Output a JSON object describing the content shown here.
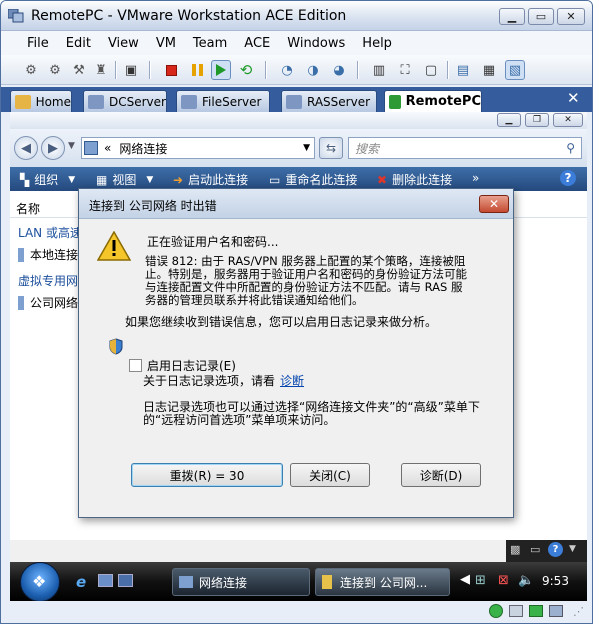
{
  "window": {
    "title": "RemotePC - VMware Workstation ACE Edition"
  },
  "menu": [
    "File",
    "Edit",
    "View",
    "VM",
    "Team",
    "ACE",
    "Windows",
    "Help"
  ],
  "tabs": [
    {
      "label": "Home"
    },
    {
      "label": "DCServer"
    },
    {
      "label": "FileServer"
    },
    {
      "label": "RASServer"
    },
    {
      "label": "RemotePC",
      "active": true
    }
  ],
  "guest": {
    "address_prefix": "«",
    "address": "网络连接",
    "search_placeholder": "搜索",
    "commands": [
      "组织",
      "视图",
      "启动此连接",
      "重命名此连接",
      "删除此连接"
    ],
    "more": "»",
    "column_name": "名称",
    "list": [
      "LAN 或高速",
      "本地连接",
      "虚拟专用网",
      "公司网络"
    ],
    "taskbar": {
      "btn1": "网络连接",
      "btn2": "连接到 公司网...",
      "clock": "9:53"
    }
  },
  "dialog": {
    "title": "连接到 公司网络 时出错",
    "status": "正在验证用户名和密码...",
    "error": "错误 812: 由于 RAS/VPN 服务器上配置的某个策略，连接被阻止。特别是，服务器用于验证用户名和密码的身份验证方法可能与连接配置文件中所配置的身份验证方法不匹配。请与 RAS 服务器的管理员联系并将此错误通知给他们。",
    "log_hint": "如果您继续收到错误信息，您可以启用日志记录来做分析。",
    "checkbox_label": "启用日志记录(E)",
    "about_log": "关于日志记录选项，请看",
    "diag_link": "诊断",
    "advanced_note": "日志记录选项也可以通过选择“网络连接文件夹”的“高级”菜单下的“远程访问首选项”菜单项来访问。",
    "btn_redial": "重拨(R) = 30",
    "btn_close": "关闭(C)",
    "btn_diag": "诊断(D)",
    "checked": false
  },
  "colors": {
    "tabbar": "#355d9d",
    "cmdbar": "#24497e",
    "link": "#0645ad"
  }
}
